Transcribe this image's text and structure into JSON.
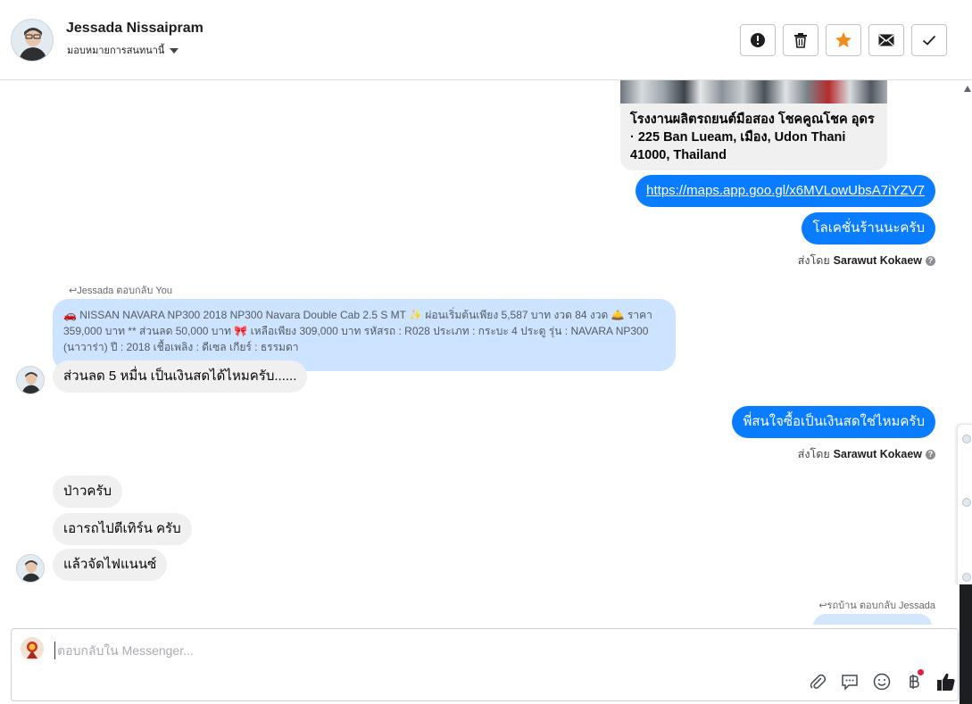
{
  "header": {
    "name": "Jessada Nissaipram",
    "subtitle": "มอบหมายการสนทนานี้"
  },
  "actions": [
    {
      "icon": "alert-icon",
      "color": "#1c1e21"
    },
    {
      "icon": "trash-icon",
      "color": "#1c1e21"
    },
    {
      "icon": "star-icon",
      "color": "#f28b1d"
    },
    {
      "icon": "envelope-icon",
      "color": "#1c1e21"
    },
    {
      "icon": "checkmark-icon",
      "color": "#1c1e21"
    }
  ],
  "messages": {
    "card_text": "โรงงานผลิตรถยนต์มือสอง โชคคูณโชค อุดร · 225 Ban Lueam, เมือง, Udon Thani 41000, Thailand",
    "map_link": "https://maps.app.goo.gl/x6MVLowUbsA7iYZV7",
    "location_msg": "โลเคชั่นร้านนะครับ",
    "sent_by_prefix": "ส่งโดย",
    "sent_by_name": "Sarawut Kokaew",
    "reply_label_1": "Jessada ตอบกลับ You",
    "quoted_text": "🚗 NISSAN NAVARA NP300 2018 NP300 Navara Double Cab 2.5 S MT ✨ ผ่อนเริ่มต้นเพียง 5,587 บาท งวด 84 งวด 🛎️ ราคา 359,000 บาท ** ส่วนลด 50,000 บาท 🎀 เหลือเพียง 309,000 บาท รหัสรถ : R028 ประเภท : กระบะ 4 ประตู รุ่น : NAVARA NP300 (นาวาร่า) ปี : 2018 เชื้อเพลิง : ดีเซล เกียร์ : ธรรมดา",
    "in_discount": "ส่วนลด 5 หมื่น เป็นเงินสดได้ไหมครับ......",
    "out_question": "พี่สนใจซื้อเป็นเงินสดใช่ไหมครับ",
    "in_no": "ป่าวครับ",
    "in_trade": "เอารถไปตีเทิร์น ครับ",
    "in_finance": "แล้วจัดไฟแนนซ์",
    "reply_label_2": "รถบ้าน ตอบกลับ Jessada"
  },
  "composer": {
    "placeholder": "ตอบกลับใน Messenger..."
  },
  "colors": {
    "outgoing": "#0a7cff",
    "incoming": "#f0f0f0",
    "quoted": "#cce4ff",
    "accent_star": "#f28b1d"
  }
}
